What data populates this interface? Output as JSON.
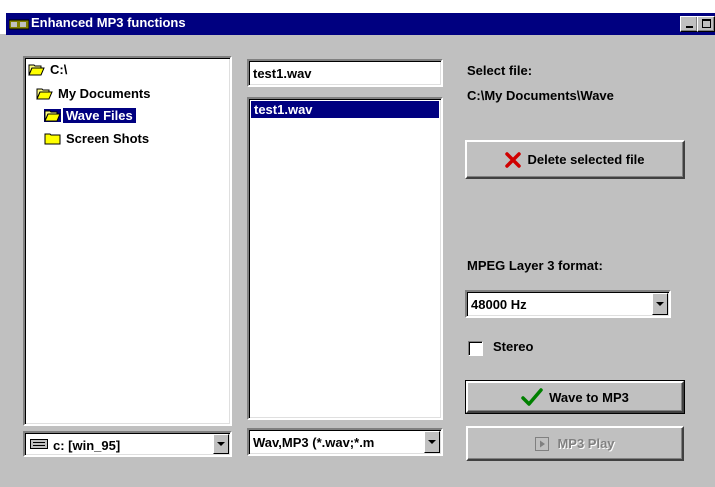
{
  "window": {
    "title": "Enhanced MP3 functions"
  },
  "tree": {
    "items": [
      {
        "label": "C:\\",
        "selected": false
      },
      {
        "label": "My Documents",
        "selected": false
      },
      {
        "label": "Wave Files",
        "selected": true
      },
      {
        "label": "Screen Shots",
        "selected": false
      }
    ]
  },
  "drive_combo": {
    "value": "c: [win_95]"
  },
  "filename_input": {
    "value": "test1.wav"
  },
  "file_list": {
    "items": [
      "test1.wav"
    ]
  },
  "filter_combo": {
    "value": "Wav,MP3 (*.wav;*.m"
  },
  "select_file": {
    "heading": "Select file:",
    "path": "C:\\My Documents\\Wave"
  },
  "delete_button": {
    "label": "Delete selected file"
  },
  "format": {
    "heading": "MPEG Layer 3 format:",
    "value": "48000 Hz"
  },
  "stereo": {
    "label": "Stereo",
    "checked": false
  },
  "convert_button": {
    "label": "Wave to MP3"
  },
  "play_button": {
    "label": "MP3 Play",
    "enabled": false
  },
  "colors": {
    "titlebar": "#000080",
    "face": "#c0c0c0",
    "selection": "#000080"
  }
}
